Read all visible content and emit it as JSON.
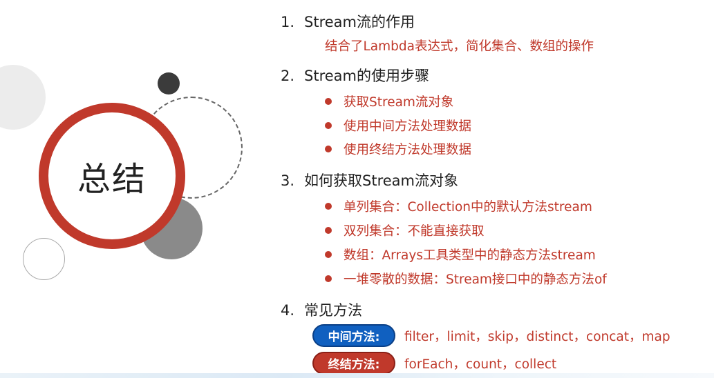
{
  "title": "总结",
  "sections": [
    {
      "num": "1.",
      "heading": "Stream流的作用",
      "desc": "结合了Lambda表达式，简化集合、数组的操作"
    },
    {
      "num": "2.",
      "heading": "Stream的使用步骤",
      "bullets": [
        "获取Stream流对象",
        "使用中间方法处理数据",
        "使用终结方法处理数据"
      ]
    },
    {
      "num": "3.",
      "heading": "如何获取Stream流对象",
      "bullets": [
        "单列集合：Collection中的默认方法stream",
        "双列集合：不能直接获取",
        "数组：Arrays工具类型中的静态方法stream",
        "一堆零散的数据：Stream接口中的静态方法of"
      ]
    },
    {
      "num": "4.",
      "heading": "常见方法"
    }
  ],
  "methods": {
    "intermediate_label": "中间方法:",
    "intermediate_list": "filter，limit，skip，distinct，concat，map",
    "terminal_label": "终结方法:",
    "terminal_list": "forEach，count，collect"
  },
  "colors": {
    "accent_red": "#c0392b",
    "accent_blue": "#1060c0"
  }
}
